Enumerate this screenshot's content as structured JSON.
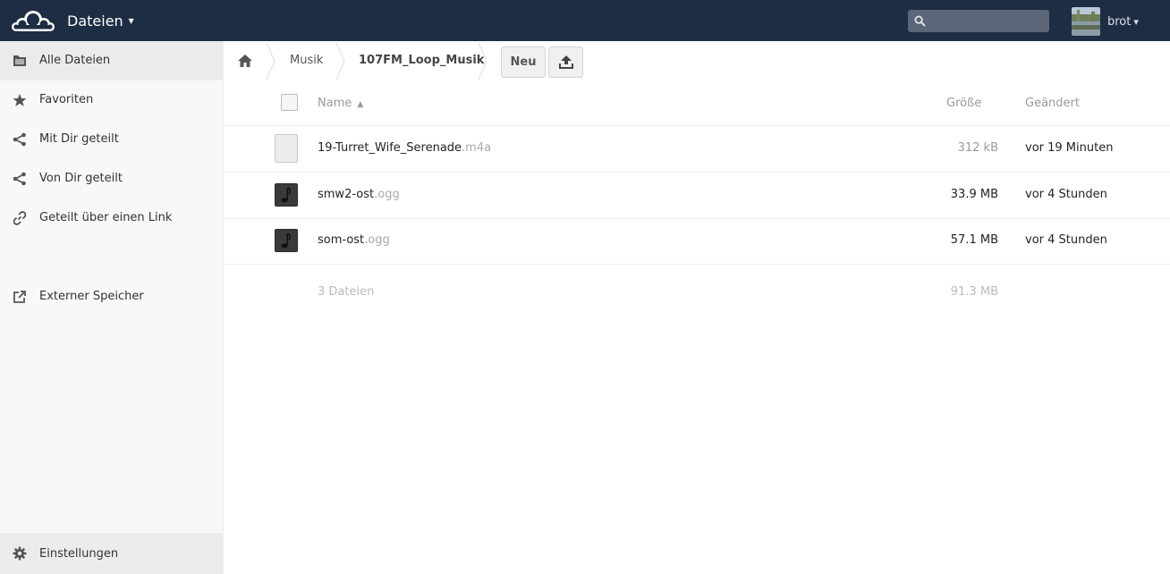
{
  "header": {
    "app_name": "Dateien",
    "app_caret": "▾",
    "search_placeholder": "",
    "user_name": "brot",
    "user_caret": "▾",
    "bg_color": "#1d2d44"
  },
  "sidebar": {
    "items": [
      {
        "label": "Alle Dateien",
        "icon": "folder-icon",
        "active": true
      },
      {
        "label": "Favoriten",
        "icon": "star-icon"
      },
      {
        "label": "Mit Dir geteilt",
        "icon": "share-icon"
      },
      {
        "label": "Von Dir geteilt",
        "icon": "share-icon"
      },
      {
        "label": "Geteilt über einen Link",
        "icon": "link-icon"
      },
      {
        "label": "Externer Speicher",
        "icon": "external-storage-icon"
      }
    ],
    "settings_label": "Einstellungen"
  },
  "breadcrumb": {
    "items": [
      "Musik",
      "107FM_Loop_Musik"
    ]
  },
  "controls": {
    "new_label": "Neu"
  },
  "table": {
    "columns": {
      "name": "Name",
      "sort_indicator": "▲",
      "size": "Größe",
      "modified": "Geändert"
    },
    "rows": [
      {
        "name": "19-Turret_Wife_Serenade",
        "ext": ".m4a",
        "size": "312 kB",
        "modified": "vor 19 Minuten",
        "icon": "file-icon",
        "size_color": "#999999"
      },
      {
        "name": "smw2-ost",
        "ext": ".ogg",
        "size": "33.9 MB",
        "modified": "vor 4 Stunden",
        "icon": "music-file-icon",
        "size_color": "#222222"
      },
      {
        "name": "som-ost",
        "ext": ".ogg",
        "size": "57.1 MB",
        "modified": "vor 4 Stunden",
        "icon": "music-file-icon",
        "size_color": "#222222"
      }
    ],
    "summary": {
      "count": "3 Dateien",
      "total": "91.3 MB"
    }
  }
}
